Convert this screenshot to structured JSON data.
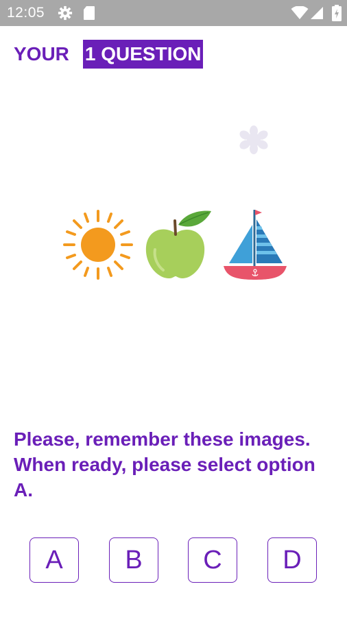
{
  "status_bar": {
    "time": "12:05",
    "icons": [
      "settings-icon",
      "sd-card-icon",
      "wifi-icon",
      "signal-icon",
      "battery-charging-icon"
    ]
  },
  "header": {
    "prefix": "YOUR",
    "highlight": "1 QUESTION"
  },
  "pictures": [
    {
      "icon": "sun-icon"
    },
    {
      "icon": "green-apple-icon"
    },
    {
      "icon": "sailboat-icon"
    }
  ],
  "instructions": "Please, remember these images. When ready, please select option A.",
  "options": [
    {
      "label": "A"
    },
    {
      "label": "B"
    },
    {
      "label": "C"
    },
    {
      "label": "D"
    }
  ],
  "colors": {
    "accent": "#6a1fb8",
    "status_bar": "#a8a8a8",
    "sun": "#f39a1e",
    "apple": "#a7cf5b",
    "leaf": "#5aa83a",
    "sail_blue": "#3fa0d8",
    "hull": "#e8546a"
  }
}
